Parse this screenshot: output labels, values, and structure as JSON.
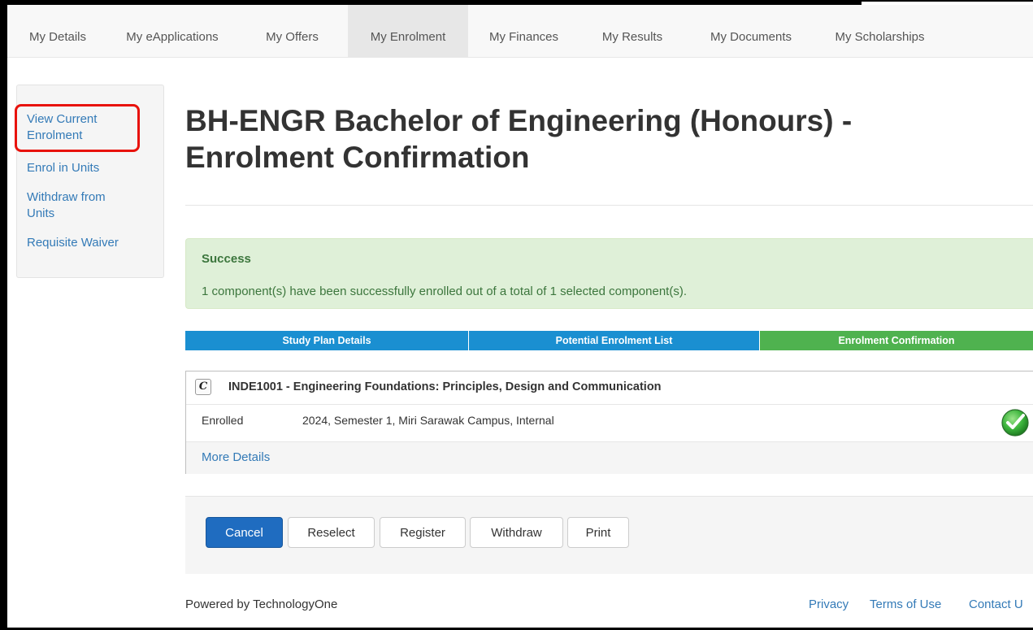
{
  "nav": {
    "tabs": [
      {
        "label": "My Details"
      },
      {
        "label": "My eApplications"
      },
      {
        "label": "My Offers"
      },
      {
        "label": "My Enrolment"
      },
      {
        "label": "My Finances"
      },
      {
        "label": "My Results"
      },
      {
        "label": "My Documents"
      },
      {
        "label": "My Scholarships"
      }
    ],
    "active": "My Enrolment"
  },
  "sidebar": {
    "items": [
      {
        "label": "View Current Enrolment"
      },
      {
        "label": "Enrol in Units"
      },
      {
        "label": "Withdraw from Units"
      },
      {
        "label": "Requisite Waiver"
      }
    ]
  },
  "page": {
    "title_line1": "BH-ENGR Bachelor of Engineering (Honours) -",
    "title_line2": "Enrolment Confirmation"
  },
  "alert": {
    "title": "Success",
    "message": "1 component(s) have been successfully enrolled out of a total of 1 selected component(s)."
  },
  "steps": [
    {
      "label": "Study Plan Details"
    },
    {
      "label": "Potential Enrolment List"
    },
    {
      "label": "Enrolment Confirmation"
    }
  ],
  "unit": {
    "badge": "C",
    "title": "INDE1001 - Engineering Foundations: Principles, Design and Communication",
    "status": "Enrolled",
    "session": "2024, Semester 1, Miri Sarawak Campus, Internal",
    "status_icon": "check-circle-icon",
    "more": "More Details"
  },
  "buttons": {
    "cancel": "Cancel",
    "reselect": "Reselect",
    "register": "Register",
    "withdraw": "Withdraw",
    "print": "Print"
  },
  "footer": {
    "powered": "Powered by TechnologyOne",
    "privacy": "Privacy",
    "terms": "Terms of Use",
    "contact": "Contact U"
  },
  "colors": {
    "link": "#337ab7",
    "primary_button": "#1f6cc0",
    "step_blue": "#1a8fd1",
    "step_green": "#4fb24f",
    "alert_bg": "#dff0d8",
    "highlight": "#e8120c"
  }
}
